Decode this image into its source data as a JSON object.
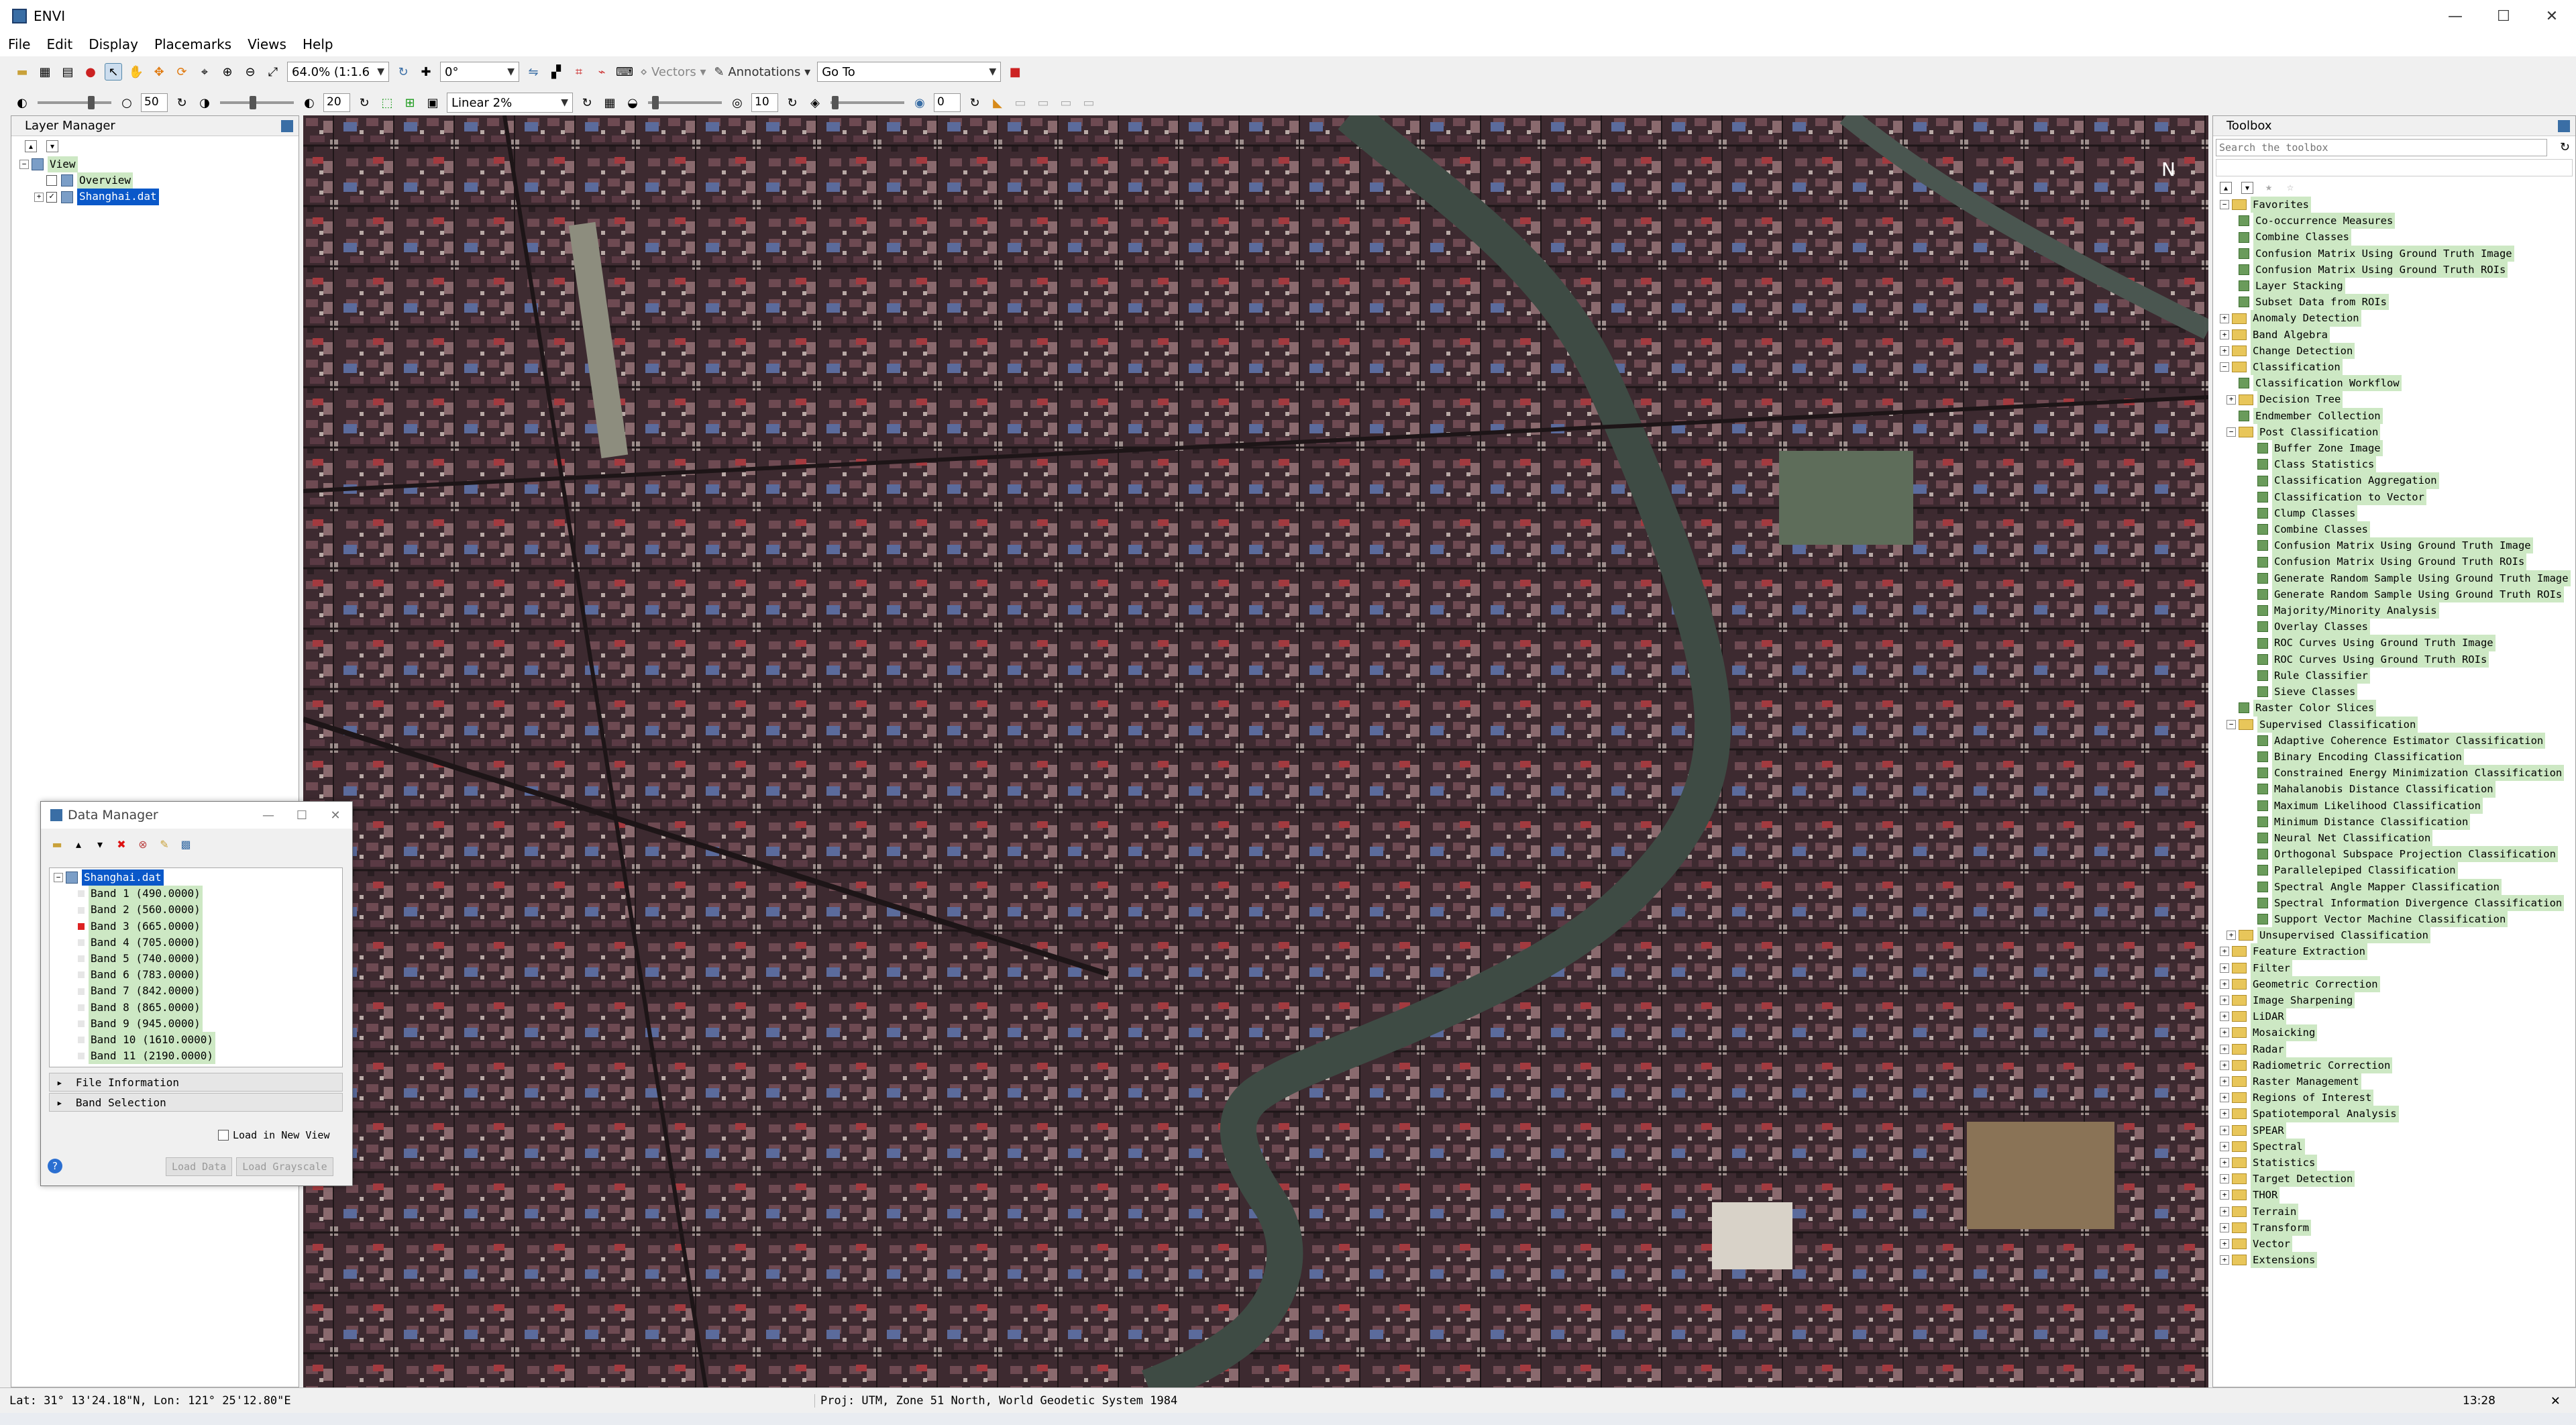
{
  "window": {
    "title": "ENVI",
    "controls": [
      "—",
      "☐",
      "✕"
    ]
  },
  "menu": [
    "File",
    "Edit",
    "Display",
    "Placemarks",
    "Views",
    "Help"
  ],
  "toolbar1": {
    "zoom_value": "64.0% (1:1.6",
    "rotation_value": "0°",
    "vectors_label": "Vectors",
    "annotations_label": "Annotations",
    "goto_value": "Go To"
  },
  "toolbar2": {
    "brightness_value": "50",
    "contrast_value": "20",
    "stretch_value": "Linear 2%",
    "sharpen_value": "10",
    "transparency_value": "0"
  },
  "layer_manager": {
    "title": "Layer Manager",
    "view_label": "View",
    "layers": [
      {
        "label": "Overview",
        "checked": false
      },
      {
        "label": "Shanghai.dat",
        "checked": true,
        "selected": true
      }
    ]
  },
  "toolbox": {
    "title": "Toolbox",
    "search_placeholder": "Search the toolbox",
    "favorites": {
      "label": "Favorites",
      "items": [
        "Co-occurrence Measures",
        "Combine Classes",
        "Confusion Matrix Using Ground Truth Image",
        "Confusion Matrix Using Ground Truth ROIs",
        "Layer Stacking",
        "Subset Data from ROIs"
      ]
    },
    "categories_top": [
      "Anomaly Detection",
      "Band Algebra",
      "Change Detection"
    ],
    "classification": {
      "label": "Classification",
      "workflow": "Classification Workflow",
      "decision_tree": "Decision Tree",
      "endmember": "Endmember Collection",
      "post": {
        "label": "Post Classification",
        "items": [
          "Buffer Zone Image",
          "Class Statistics",
          "Classification Aggregation",
          "Classification to Vector",
          "Clump Classes",
          "Combine Classes",
          "Confusion Matrix Using Ground Truth Image",
          "Confusion Matrix Using Ground Truth ROIs",
          "Generate Random Sample Using Ground Truth Image",
          "Generate Random Sample Using Ground Truth ROIs",
          "Majority/Minority Analysis",
          "Overlay Classes",
          "ROC Curves Using Ground Truth Image",
          "ROC Curves Using Ground Truth ROIs",
          "Rule Classifier",
          "Sieve Classes"
        ]
      },
      "raster_color_slices": "Raster Color Slices",
      "supervised": {
        "label": "Supervised Classification",
        "items": [
          "Adaptive Coherence Estimator Classification",
          "Binary Encoding Classification",
          "Constrained Energy Minimization Classification",
          "Mahalanobis Distance Classification",
          "Maximum Likelihood Classification",
          "Minimum Distance Classification",
          "Neural Net Classification",
          "Orthogonal Subspace Projection Classification",
          "Parallelepiped Classification",
          "Spectral Angle Mapper Classification",
          "Spectral Information Divergence Classification",
          "Support Vector Machine Classification"
        ]
      },
      "unsupervised": "Unsupervised Classification"
    },
    "categories_bottom": [
      "Feature Extraction",
      "Filter",
      "Geometric Correction",
      "Image Sharpening",
      "LiDAR",
      "Mosaicking",
      "Radar",
      "Radiometric Correction",
      "Raster Management",
      "Regions of Interest",
      "Spatiotemporal Analysis",
      "SPEAR",
      "Spectral",
      "Statistics",
      "Target Detection",
      "THOR",
      "Terrain",
      "Transform",
      "Vector",
      "Extensions"
    ]
  },
  "data_manager": {
    "title": "Data Manager",
    "file": "Shanghai.dat",
    "bands": [
      {
        "label": "Band 1 (490.0000)",
        "color": "#e6e6e6"
      },
      {
        "label": "Band 2 (560.0000)",
        "color": "#e6e6e6"
      },
      {
        "label": "Band 3 (665.0000)",
        "color": "#d22"
      },
      {
        "label": "Band 4 (705.0000)",
        "color": "#e6e6e6"
      },
      {
        "label": "Band 5 (740.0000)",
        "color": "#e6e6e6"
      },
      {
        "label": "Band 6 (783.0000)",
        "color": "#e6e6e6"
      },
      {
        "label": "Band 7 (842.0000)",
        "color": "#e6e6e6"
      },
      {
        "label": "Band 8 (865.0000)",
        "color": "#e6e6e6"
      },
      {
        "label": "Band 9 (945.0000)",
        "color": "#e6e6e6"
      },
      {
        "label": "Band 10 (1610.0000)",
        "color": "#e6e6e6"
      },
      {
        "label": "Band 11 (2190.0000)",
        "color": "#e6e6e6"
      }
    ],
    "file_info_label": "File Information",
    "band_selection_label": "Band Selection",
    "load_new_view_label": "Load in New View",
    "load_data_label": "Load Data",
    "load_grayscale_label": "Load Grayscale"
  },
  "status": {
    "coords": "Lat: 31° 13'24.18\"N, Lon: 121° 25'12.80\"E",
    "projection": "Proj: UTM, Zone 51 North, World Geodetic System 1984",
    "clock": "13:28"
  },
  "map": {
    "north_label": "N"
  }
}
